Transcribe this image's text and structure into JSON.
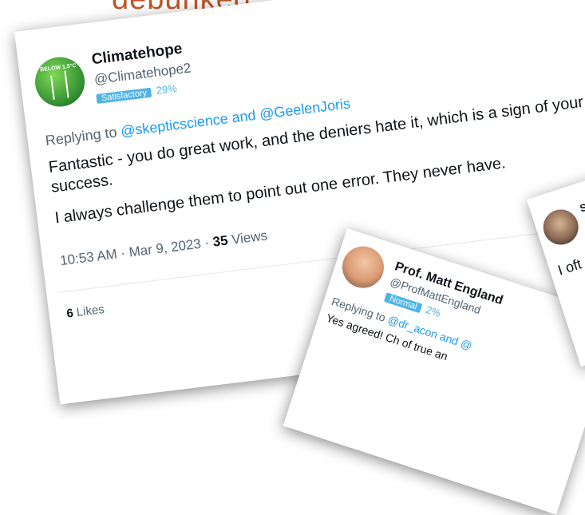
{
  "headline": "debunked.",
  "tweet_main": {
    "name": "Climatehope",
    "handle": "@Climatehope2",
    "badge": "Satisfactory",
    "badge_pct": "29%",
    "replying_prefix": "Replying to ",
    "replying_to": "@skepticscience and @GeelenJoris",
    "paragraph1": "Fantastic - you do great work, and the deniers hate it, which is a sign of your success.",
    "paragraph2": "I always challenge them to point out one error. They never have.",
    "time": "10:53 AM · Mar 9, 2023 · ",
    "views_count": "35",
    "views_label": " Views",
    "likes_count": "6",
    "likes_label": " Likes",
    "more": "···",
    "avatar_text": "BELOW 1.5°C"
  },
  "tweet_england": {
    "name": "Prof. Matt England",
    "handle": "@ProfMattEngland",
    "badge": "Normal",
    "badge_pct": "2%",
    "replying_prefix": "Replying to ",
    "replying_to": "@dr_acon and @",
    "text": "Yes agreed!  Ch of true an"
  },
  "tweet_third": {
    "name": "St",
    "text": "I oft aro fi"
  },
  "colors": {
    "headline": "#c0552a",
    "link": "#1d9bf0",
    "badge": "#4fb3e8"
  }
}
